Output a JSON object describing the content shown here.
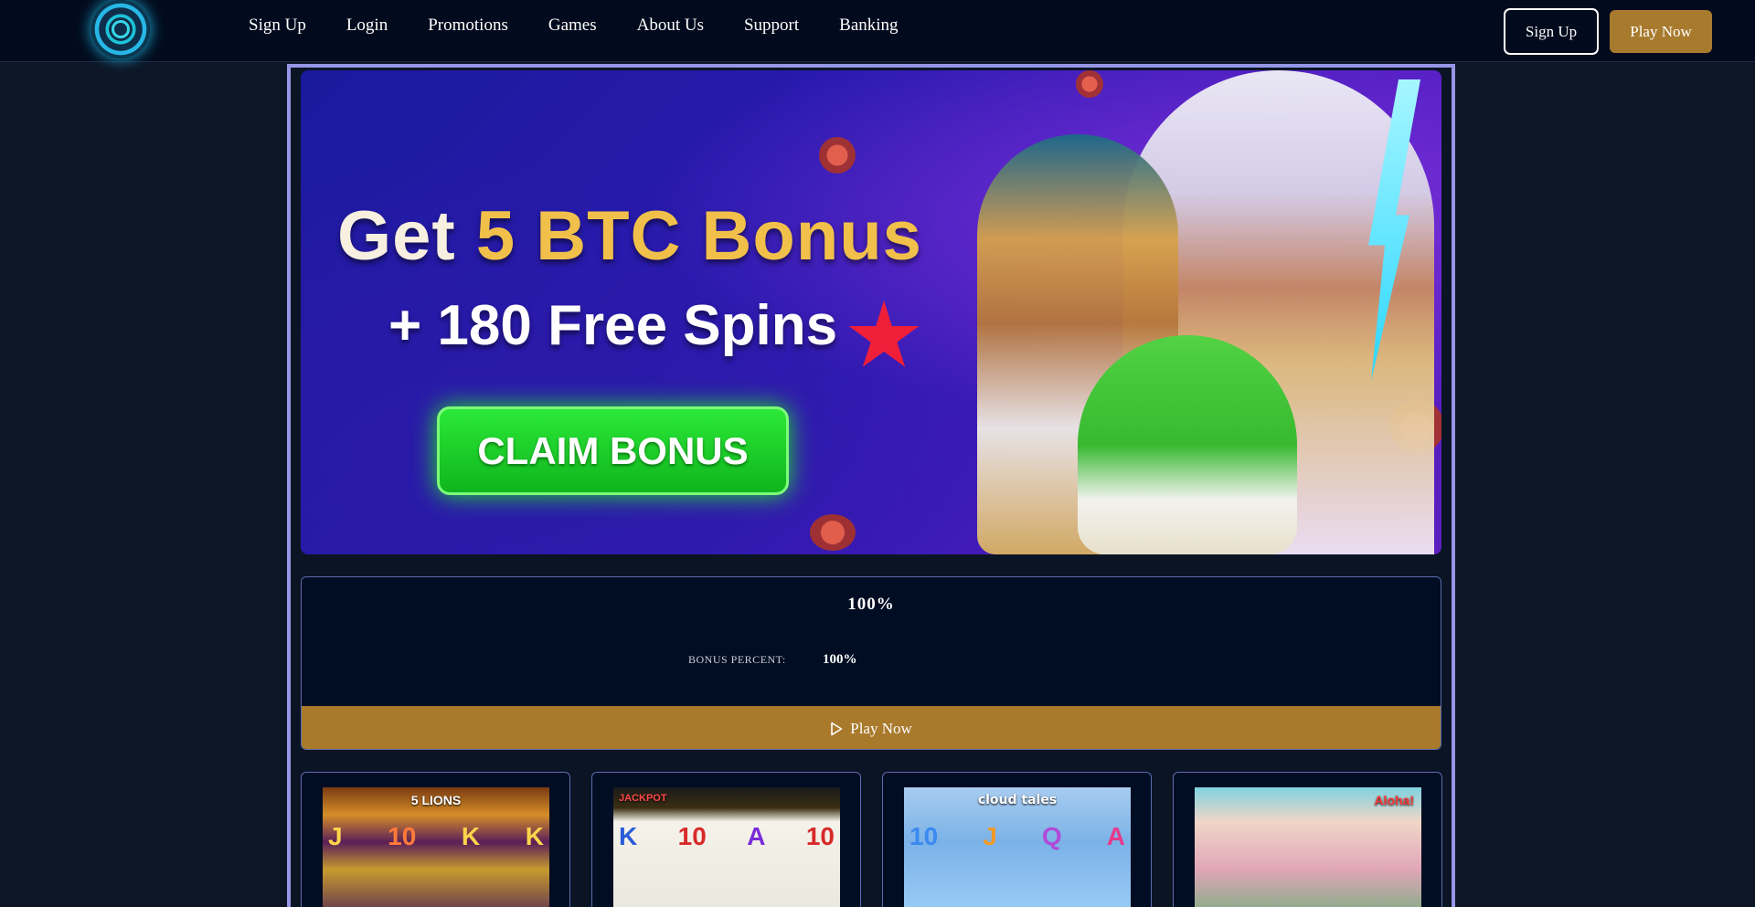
{
  "header": {
    "nav": [
      "Sign Up",
      "Login",
      "Promotions",
      "Games",
      "About Us",
      "Support",
      "Banking"
    ],
    "signup_label": "Sign Up",
    "play_label": "Play Now"
  },
  "banner": {
    "title_prefix": "Get ",
    "title_highlight": "5 BTC Bonus",
    "subtitle": "+ 180 Free Spins",
    "cta": "CLAIM BONUS"
  },
  "bonus": {
    "headline": "100%",
    "label": "BONUS PERCENT:",
    "value": "100%",
    "play_label": "Play Now"
  },
  "games": [
    {
      "title": "5 LIONS",
      "reels": [
        "J",
        "10",
        "K",
        "K"
      ]
    },
    {
      "title": "JACKPOT",
      "reels": [
        "K",
        "10",
        "A",
        "10"
      ]
    },
    {
      "title": "cloud tales",
      "reels": [
        "10",
        "J",
        "Q",
        "A"
      ]
    },
    {
      "title": "Aloha!",
      "reels": [
        "",
        "",
        "",
        ""
      ]
    }
  ],
  "colors": {
    "header_bg": "#020b1d",
    "gold_button": "#a87a2d",
    "frame_border": "#9596e6",
    "claim_green": "#1fd12a"
  }
}
